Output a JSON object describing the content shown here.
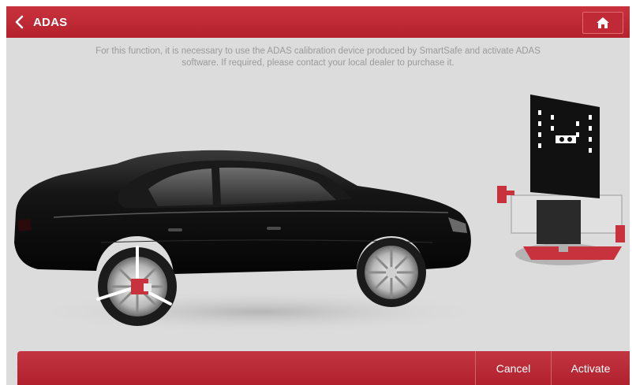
{
  "header": {
    "title": "ADAS",
    "back_icon": "chevron-left-icon",
    "home_icon": "home-icon"
  },
  "notice": {
    "line1": "For this function, it is necessary to use the ADAS calibration device produced by SmartSafe and activate ADAS",
    "line2": "software. If required, please contact your local dealer to purchase it."
  },
  "footer": {
    "cancel_label": "Cancel",
    "activate_label": "Activate"
  },
  "colors": {
    "brand_red": "#b4222e",
    "background": "#dcdcdc",
    "notice_text": "#9a9a9a"
  }
}
